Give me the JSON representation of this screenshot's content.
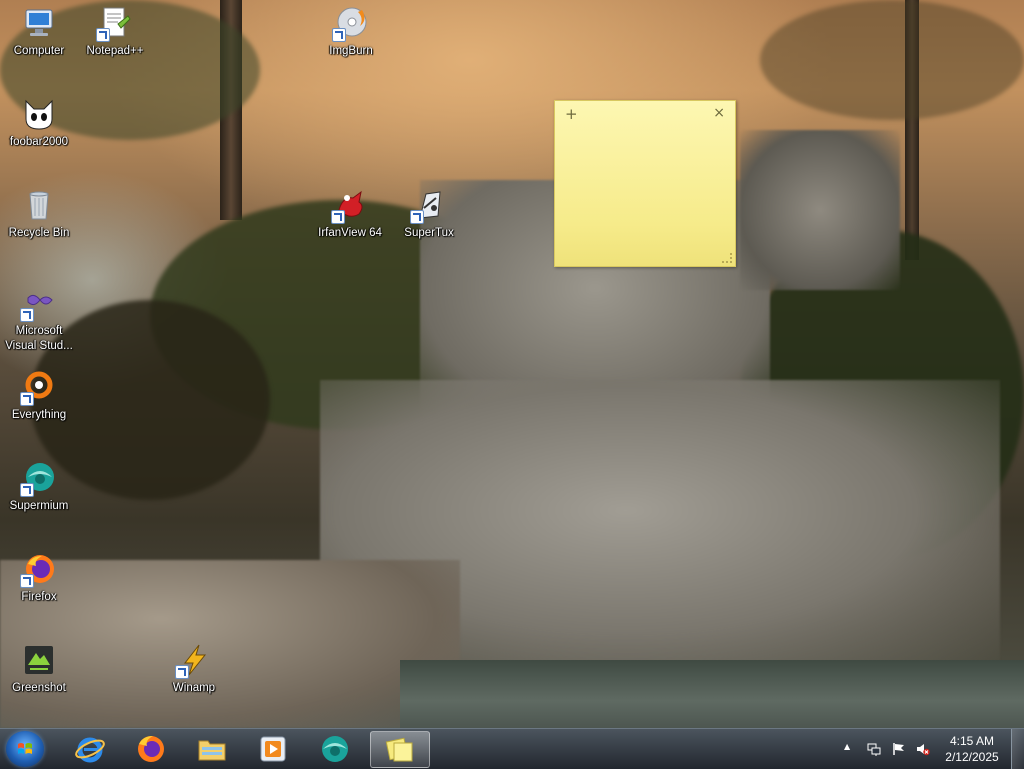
{
  "desktop": {
    "icons": [
      {
        "label": "Computer",
        "icon": "computer-icon"
      },
      {
        "label": "Notepad++",
        "icon": "notepadpp-icon"
      },
      {
        "label": "ImgBurn",
        "icon": "imgburn-icon"
      },
      {
        "label": "foobar2000",
        "icon": "foobar2000-icon"
      },
      {
        "label": "Recycle Bin",
        "icon": "recycle-bin-icon"
      },
      {
        "label": "IrfanView 64",
        "icon": "irfanview-icon"
      },
      {
        "label": "SuperTux",
        "icon": "supertux-icon"
      },
      {
        "label": "Microsoft Visual Stud...",
        "icon": "visual-studio-icon"
      },
      {
        "label": "Everything",
        "icon": "everything-icon"
      },
      {
        "label": "Supermium",
        "icon": "supermium-icon"
      },
      {
        "label": "Firefox",
        "icon": "firefox-icon"
      },
      {
        "label": "Greenshot",
        "icon": "greenshot-icon"
      },
      {
        "label": "Winamp",
        "icon": "winamp-icon"
      }
    ]
  },
  "sticky_note": {
    "add_glyph": "+",
    "close_glyph": "×",
    "text": ""
  },
  "taskbar": {
    "start_icon": "windows-start-icon",
    "pinned": [
      {
        "app": "Internet Explorer",
        "icon": "internet-explorer-icon",
        "active": false
      },
      {
        "app": "Firefox",
        "icon": "firefox-icon",
        "active": false
      },
      {
        "app": "File Explorer",
        "icon": "folder-icon",
        "active": false
      },
      {
        "app": "Media Player",
        "icon": "media-player-icon",
        "active": false
      },
      {
        "app": "Supermium",
        "icon": "supermium-icon",
        "active": false
      },
      {
        "app": "Sticky Notes",
        "icon": "sticky-notes-icon",
        "active": true
      }
    ],
    "tray": {
      "overflow_glyph": "▲",
      "icons": [
        "network-icon",
        "action-center-flag-icon",
        "volume-muted-icon"
      ],
      "time": "4:15 AM",
      "date": "2/12/2025"
    }
  },
  "colors": {
    "sticky_bg": "#f8ef9a",
    "taskbar_bg": "#1e252d",
    "accent": "#2e63b8"
  }
}
